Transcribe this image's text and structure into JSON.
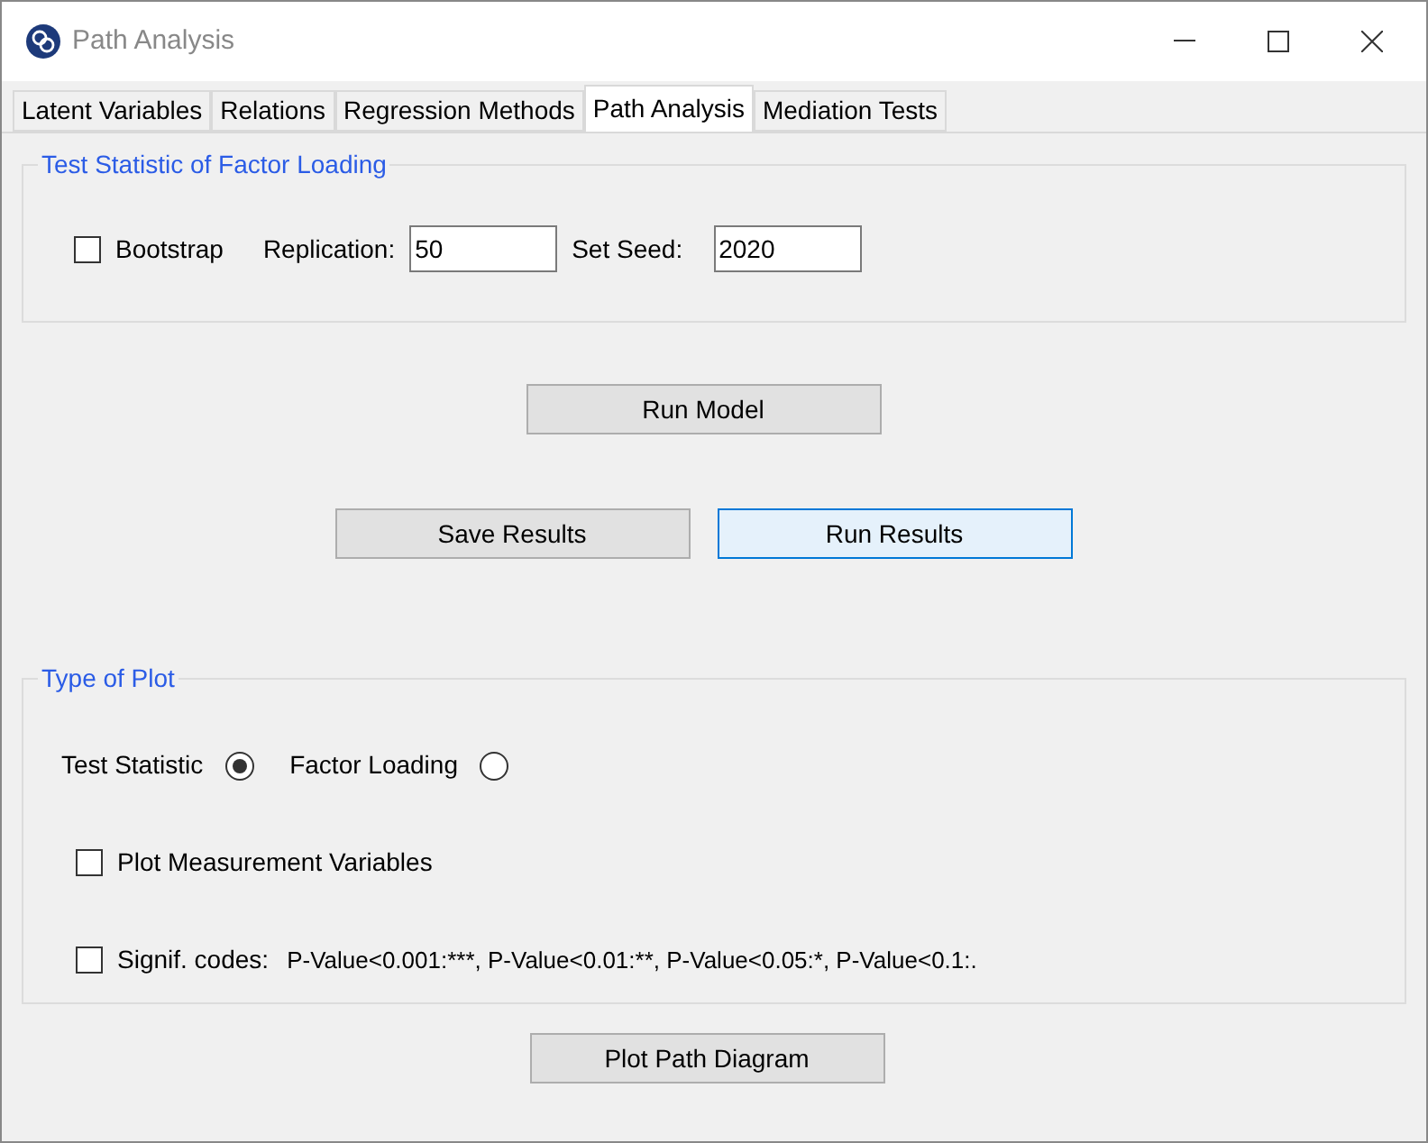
{
  "window": {
    "title": "Path Analysis"
  },
  "tabs": [
    {
      "label": "Latent Variables",
      "selected": false
    },
    {
      "label": "Relations",
      "selected": false
    },
    {
      "label": "Regression Methods",
      "selected": false
    },
    {
      "label": "Path Analysis",
      "selected": true
    },
    {
      "label": "Mediation Tests",
      "selected": false
    }
  ],
  "test_statistic_group": {
    "title": "Test Statistic of Factor Loading",
    "bootstrap": {
      "label": "Bootstrap",
      "checked": false
    },
    "replication": {
      "label": "Replication:",
      "value": "50"
    },
    "seed": {
      "label": "Set Seed:",
      "value": "2020"
    }
  },
  "run_model_button": {
    "label": "Run Model",
    "focused": false
  },
  "result_buttons": [
    {
      "label": "Save Results",
      "focused": false
    },
    {
      "label": "Run Results",
      "focused": true
    }
  ],
  "plot_group": {
    "title": "Type of Plot",
    "radios": [
      {
        "label": "Test Statistic",
        "selected": true
      },
      {
        "label": "Factor Loading",
        "selected": false
      }
    ],
    "plot_measurement": {
      "label": "Plot Measurement Variables",
      "checked": false
    },
    "signif": {
      "label": "Signif. codes:",
      "codes": "P-Value<0.001:***, P-Value<0.01:**, P-Value<0.05:*, P-Value<0.1:.",
      "checked": false
    }
  },
  "plot_button": {
    "label": "Plot Path Diagram",
    "focused": false
  }
}
